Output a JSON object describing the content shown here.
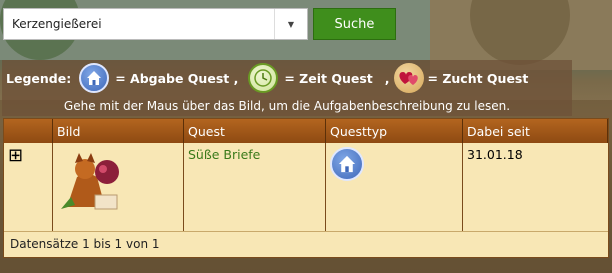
{
  "search": {
    "value": "Kerzengießerei",
    "button_label": "Suche"
  },
  "legend": {
    "label": "Legende:",
    "abgabe": "= Abgabe Quest ,",
    "zeit": "= Zeit Quest",
    "zeit_sep": ",",
    "zucht": "= Zucht Quest",
    "hint": "Gehe mit der Maus über das Bild, um die Aufgabenbeschreibung zu lesen."
  },
  "table": {
    "headers": [
      "",
      "Bild",
      "Quest",
      "Questtyp",
      "Dabei seit"
    ],
    "rows": [
      {
        "expand": "⊞",
        "quest": "Süße Briefe",
        "since": "31.01.18"
      }
    ],
    "footer": "Datensätze 1 bis 1 von 1"
  },
  "colors": {
    "accent": "#3f8e1c",
    "header": "#9e5616",
    "row": "#f8e7b5"
  }
}
